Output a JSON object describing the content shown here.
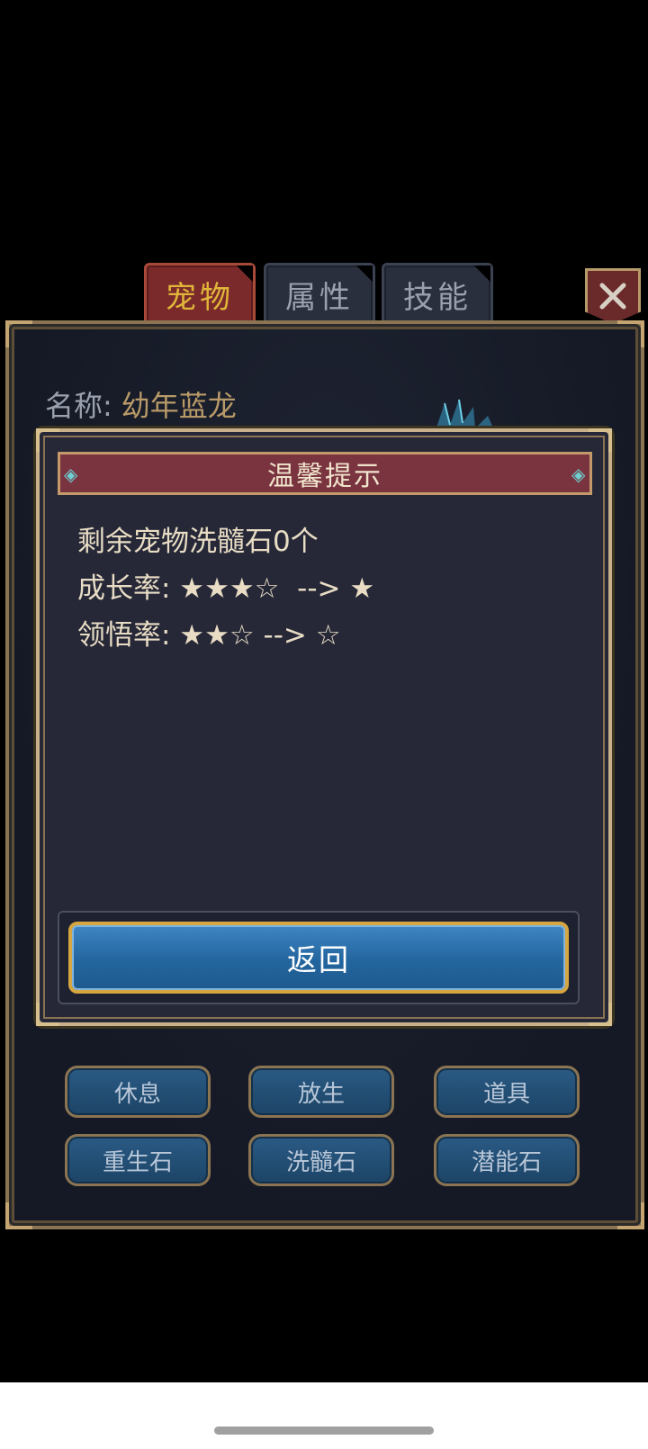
{
  "tabs": [
    {
      "label": "宠物",
      "active": true
    },
    {
      "label": "属性",
      "active": false
    },
    {
      "label": "技能",
      "active": false
    }
  ],
  "close_icon": "close-icon",
  "pet": {
    "name_label": "名称:",
    "name_value": "幼年蓝龙"
  },
  "dialog": {
    "title": "温馨提示",
    "lines": [
      "剩余宠物洗髓石0个",
      "成长率: ★★★☆  --> ★",
      "领悟率: ★★☆ --> ☆"
    ],
    "return_label": "返回"
  },
  "actions": [
    {
      "label": "休息"
    },
    {
      "label": "放生"
    },
    {
      "label": "道具"
    },
    {
      "label": "重生石"
    },
    {
      "label": "洗髓石"
    },
    {
      "label": "潜能石"
    }
  ],
  "colors": {
    "background": "#000000",
    "panel": "#151925",
    "gold_border": "#c8b08a",
    "tab_active": "#7a2a2a",
    "dialog_header": "#7a3440",
    "return_button": "#2a6fa8"
  }
}
